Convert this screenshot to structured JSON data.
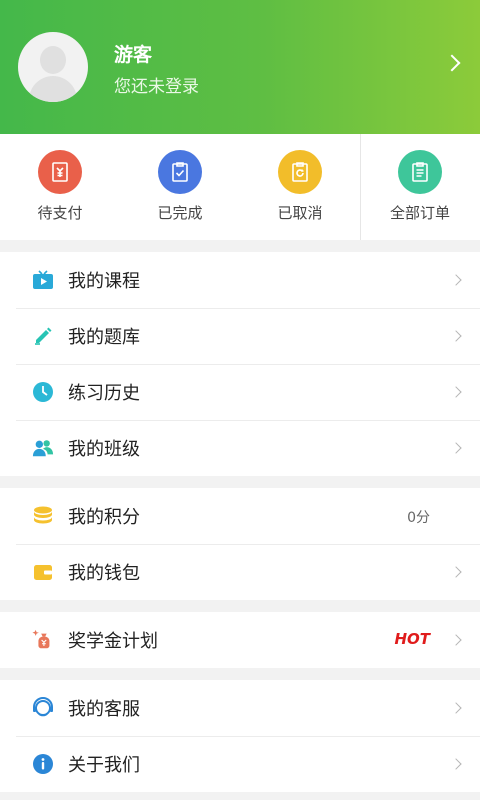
{
  "header": {
    "user_name": "游客",
    "login_status": "您还未登录"
  },
  "orders": [
    {
      "label": "待支付",
      "icon": "pending-payment-icon",
      "color": "#e9604a"
    },
    {
      "label": "已完成",
      "icon": "completed-icon",
      "color": "#4a77e0"
    },
    {
      "label": "已取消",
      "icon": "cancelled-icon",
      "color": "#f2bd2a"
    },
    {
      "label": "全部订单",
      "icon": "all-orders-icon",
      "color": "#3ec69a"
    }
  ],
  "menu": {
    "group1": [
      {
        "label": "我的课程",
        "icon": "course-tv-icon"
      },
      {
        "label": "我的题库",
        "icon": "question-bank-pencil-icon"
      },
      {
        "label": "练习历史",
        "icon": "history-clock-icon"
      },
      {
        "label": "我的班级",
        "icon": "class-users-icon"
      }
    ],
    "group2": [
      {
        "label": "我的积分",
        "icon": "points-coins-icon",
        "value": "0分"
      },
      {
        "label": "我的钱包",
        "icon": "wallet-icon"
      }
    ],
    "group3": [
      {
        "label": "奖学金计划",
        "icon": "scholarship-icon",
        "badge": "HOT"
      }
    ],
    "group4": [
      {
        "label": "我的客服",
        "icon": "customer-service-icon"
      },
      {
        "label": "关于我们",
        "icon": "info-icon"
      }
    ]
  }
}
